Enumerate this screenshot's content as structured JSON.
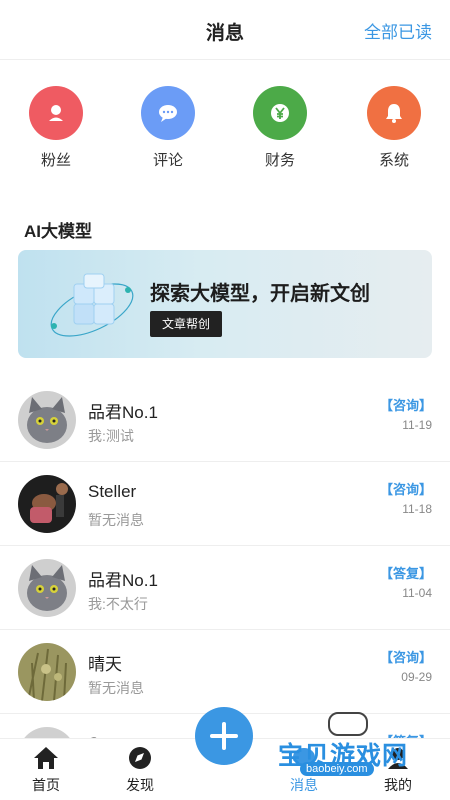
{
  "header": {
    "title": "消息",
    "read_all": "全部已读"
  },
  "categories": [
    {
      "label": "粉丝",
      "color": "#ef5b62",
      "icon": "person-icon"
    },
    {
      "label": "评论",
      "color": "#6b9cf6",
      "icon": "chat-bubble-icon"
    },
    {
      "label": "财务",
      "color": "#4caa48",
      "icon": "yen-icon"
    },
    {
      "label": "系统",
      "color": "#f07042",
      "icon": "bell-icon"
    }
  ],
  "section": {
    "title": "AI大模型"
  },
  "banner": {
    "title": "探索大模型，开启新文创",
    "button": "文章帮创"
  },
  "messages": [
    {
      "name": "品君No.1",
      "preview": "我:测试",
      "tag": "【咨询】",
      "date": "11-19",
      "avatar": "gray-cat"
    },
    {
      "name": "Steller",
      "preview": "暂无消息",
      "tag": "【咨询】",
      "date": "11-18",
      "avatar": "dark-photo"
    },
    {
      "name": "品君No.1",
      "preview": "我:不太行",
      "tag": "【答复】",
      "date": "11-04",
      "avatar": "gray-cat"
    },
    {
      "name": "晴天",
      "preview": "暂无消息",
      "tag": "【咨询】",
      "date": "09-29",
      "avatar": "grass-photo"
    },
    {
      "name": "S",
      "preview": "",
      "tag": "【答复】",
      "date": "",
      "avatar": "gray"
    }
  ],
  "tabbar": {
    "home": "首页",
    "discover": "发现",
    "messages": "消息",
    "mine": "我的"
  },
  "watermark": {
    "text": "宝贝游戏网",
    "url": "baobeiy.com"
  },
  "colors": {
    "accent": "#3b97e3"
  }
}
